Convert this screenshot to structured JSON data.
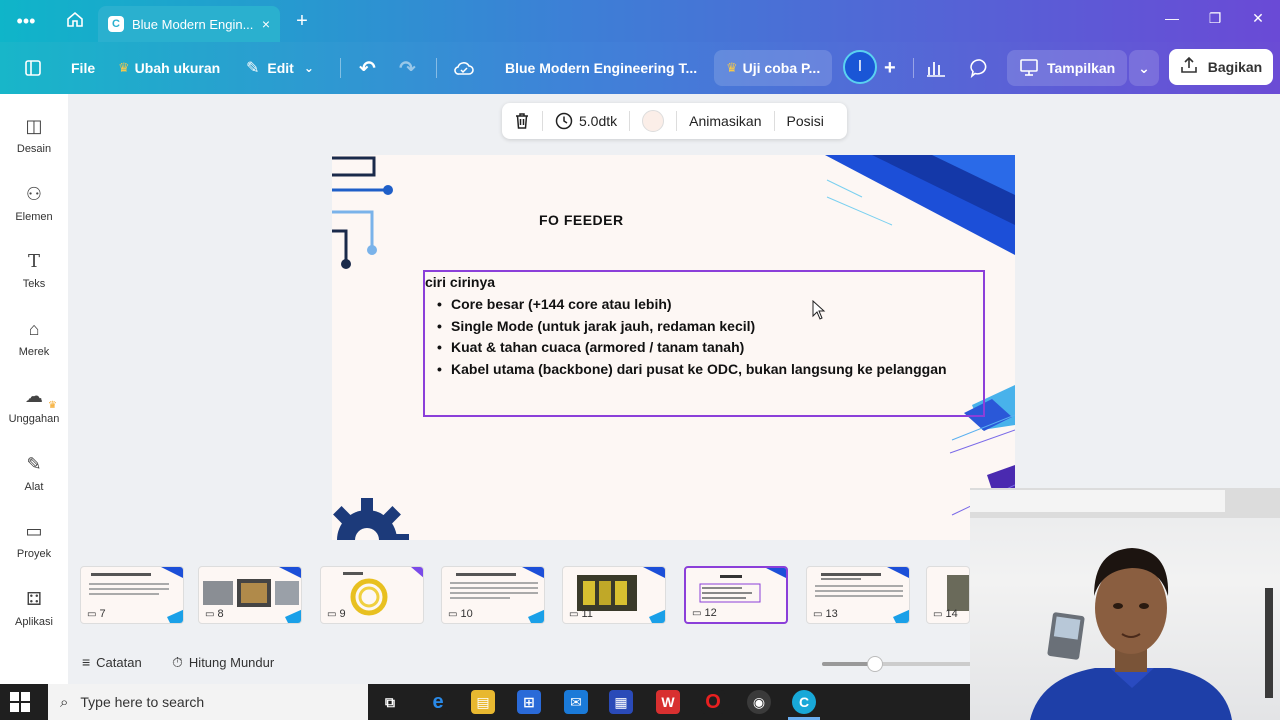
{
  "window": {
    "tab_title": "Blue Modern Engin...",
    "tab_close": "×",
    "new_tab": "+"
  },
  "toolbar": {
    "file": "File",
    "resize": "Ubah ukuran",
    "edit": "Edit",
    "doc_title": "Blue Modern Engineering T...",
    "try_pro": "Uji coba P...",
    "avatar_initial": "I",
    "present": "Tampilkan",
    "share": "Bagikan"
  },
  "sidebar": {
    "items": [
      {
        "label": "Desain",
        "icon": "design-icon"
      },
      {
        "label": "Elemen",
        "icon": "elements-icon"
      },
      {
        "label": "Teks",
        "icon": "text-icon"
      },
      {
        "label": "Merek",
        "icon": "brand-icon"
      },
      {
        "label": "Unggahan",
        "icon": "upload-icon"
      },
      {
        "label": "Alat",
        "icon": "tools-icon"
      },
      {
        "label": "Proyek",
        "icon": "projects-icon"
      },
      {
        "label": "Aplikasi",
        "icon": "apps-icon"
      }
    ]
  },
  "context_toolbar": {
    "duration": "5.0dtk",
    "animate": "Animasikan",
    "position": "Posisi",
    "swatch_color": "#fbeee8"
  },
  "slide": {
    "title": "FO FEEDER",
    "heading": "ciri cirinya",
    "bullets": [
      "Core besar (+144 core atau lebih)",
      "Single Mode (untuk jarak jauh, redaman kecil)",
      "Kuat & tahan cuaca (armored / tanam tanah)",
      "Kabel utama (backbone) dari pusat ke ODC, bukan langsung ke pelanggan"
    ]
  },
  "filmstrip": {
    "pages": [
      "7",
      "8",
      "9",
      "10",
      "11",
      "12",
      "13",
      "14"
    ],
    "active_page": "12"
  },
  "bottombar": {
    "notes": "Catatan",
    "timer": "Hitung Mundur",
    "zoom_fraction": 0.35
  },
  "taskbar": {
    "search_placeholder": "Type here to search"
  },
  "colors": {
    "accent": "#8b3fd9",
    "toolbar_start": "#18b6c9",
    "toolbar_end": "#6b4cd5"
  }
}
